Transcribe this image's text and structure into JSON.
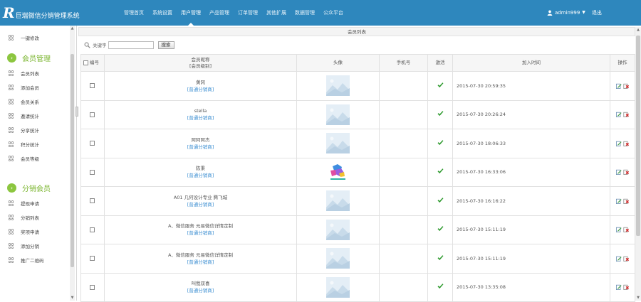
{
  "app": {
    "logo_mark": "R",
    "title": "巨瑞微信分销管理系统"
  },
  "nav": [
    {
      "label": "管理首页"
    },
    {
      "label": "系统设置"
    },
    {
      "label": "用户管理",
      "active": true
    },
    {
      "label": "产品管理"
    },
    {
      "label": "订单管理"
    },
    {
      "label": "其他扩展"
    },
    {
      "label": "数据管理"
    },
    {
      "label": "公众平台"
    }
  ],
  "user": {
    "name": "admin999",
    "logout_label": "退出"
  },
  "sidebar": {
    "items_top": [
      {
        "label": "一键修改"
      }
    ],
    "sections": [
      {
        "label": "会员管理",
        "items": [
          {
            "label": "会员列表"
          },
          {
            "label": "添加会员"
          },
          {
            "label": "会员关系"
          },
          {
            "label": "邀请统计"
          },
          {
            "label": "分享统计"
          },
          {
            "label": "积分统计"
          },
          {
            "label": "会员等级"
          }
        ]
      },
      {
        "label": "分销会员",
        "items": [
          {
            "label": "提现申请"
          },
          {
            "label": "分销列表"
          },
          {
            "label": "奖项申请"
          },
          {
            "label": "添加分销"
          },
          {
            "label": "推广二维码"
          }
        ]
      }
    ]
  },
  "page": {
    "title": "会员列表",
    "search": {
      "label": "关键字",
      "value": "",
      "placeholder": "",
      "button": "搜索"
    }
  },
  "table": {
    "columns": {
      "index": "编号",
      "nickname": "会员昵称",
      "nickname_sub": "[会员级别]",
      "avatar": "头像",
      "phone": "手机号",
      "active": "激活",
      "joined": "加入时间",
      "ops": "操作"
    },
    "rows": [
      {
        "nickname": "黄冈",
        "level": "[普通分销商]",
        "avatar": "placeholder",
        "phone": "",
        "activated": true,
        "joined": "2015-07-30 20:59:35"
      },
      {
        "nickname": "stella",
        "level": "[普通分销商]",
        "avatar": "placeholder",
        "phone": "",
        "activated": true,
        "joined": "2015-07-30 20:26:24"
      },
      {
        "nickname": "阿阿阿杰",
        "level": "[普通分销商]",
        "avatar": "placeholder",
        "phone": "",
        "activated": true,
        "joined": "2015-07-30 18:06:33"
      },
      {
        "nickname": "陈秉",
        "level": "[普通分销商]",
        "avatar": "image",
        "phone": "",
        "activated": true,
        "joined": "2015-07-30 16:33:06"
      },
      {
        "nickname": "A01 几何设计专业 腾飞城",
        "level": "[普通分销商]",
        "avatar": "placeholder",
        "phone": "",
        "activated": true,
        "joined": "2015-07-30 16:16:22"
      },
      {
        "nickname": "A、微信服务 元易微信详情定制",
        "level": "[普通分销商]",
        "avatar": "placeholder",
        "phone": "",
        "activated": true,
        "joined": "2015-07-30 15:11:19"
      },
      {
        "nickname": "A、微信服务 元易微信详情定制",
        "level": "[普通分销商]",
        "avatar": "placeholder",
        "phone": "",
        "activated": true,
        "joined": "2015-07-30 15:11:19"
      },
      {
        "nickname": "叫我双喜",
        "level": "[普通分销商]",
        "avatar": "placeholder",
        "phone": "",
        "activated": true,
        "joined": "2015-07-30 13:35:08"
      }
    ]
  },
  "colors": {
    "topbar": "#2e87bd",
    "section": "#79b42c",
    "link": "#3a8dd1",
    "check": "#2e9a2e"
  },
  "icons": {
    "user": "user-icon",
    "search": "search-icon",
    "edit": "edit-icon",
    "delete": "delete-icon",
    "check": "checkmark-icon",
    "section": "chevron-right-circle-icon"
  }
}
